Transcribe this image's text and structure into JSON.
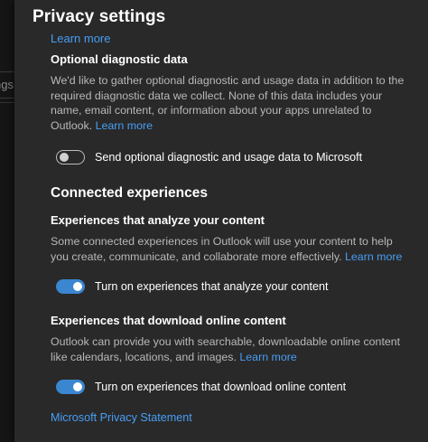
{
  "backdrop": {
    "tab_fragment": "ngs"
  },
  "dialog": {
    "title": "Privacy settings",
    "top_link": "Learn more"
  },
  "optional": {
    "heading": "Optional diagnostic data",
    "description": "We'd like to gather optional diagnostic and usage data in addition to the required diagnostic data we collect. None of this data includes your name, email content, or information about your apps unrelated to Outlook.",
    "learn_more": "Learn more",
    "toggle_label": "Send optional diagnostic and usage data to Microsoft",
    "toggle_state": "off"
  },
  "connected": {
    "heading": "Connected experiences",
    "analyze": {
      "heading": "Experiences that analyze your content",
      "description": "Some connected experiences in Outlook will use your content to help you create, communicate, and collaborate more effectively.",
      "learn_more": "Learn more",
      "toggle_label": "Turn on experiences that analyze your content",
      "toggle_state": "on"
    },
    "download": {
      "heading": "Experiences that download online content",
      "description": "Outlook can provide you with searchable, downloadable online content like calendars, locations, and images.",
      "learn_more": "Learn more",
      "toggle_label": "Turn on experiences that download online content",
      "toggle_state": "on"
    }
  },
  "footer": {
    "privacy_statement": "Microsoft Privacy Statement"
  },
  "colors": {
    "accent": "#3a86d0",
    "link": "#479ef5",
    "background": "#292929"
  }
}
